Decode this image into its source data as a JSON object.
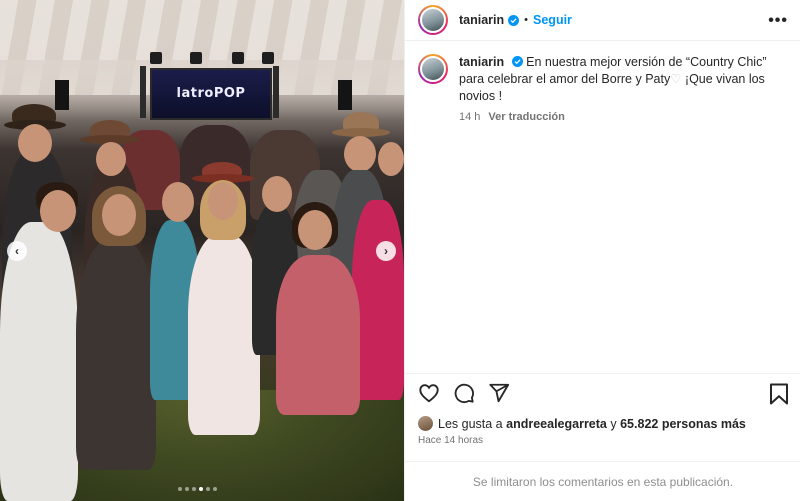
{
  "post": {
    "username": "taniarin",
    "follow_label": "Seguir",
    "separator": "•",
    "more_label": "•••"
  },
  "caption": {
    "username": "taniarin",
    "text_part1": "En nuestra mejor versión de “Country Chic” para celebrar el amor del Borre y Paty",
    "heart": "♡",
    "text_part2": " ¡Que vivan los novios !",
    "age": "14 h",
    "translate_label": "Ver traducción"
  },
  "media": {
    "screen_text": "latroPOP",
    "prev_label": "‹",
    "next_label": "›",
    "slide_count": 6,
    "active_slide": 4
  },
  "engagement": {
    "likes_prefix": "Les gusta a ",
    "liker": "andreealegarreta",
    "likes_mid": " y ",
    "likes_count": "65.822 personas más",
    "time_ago": "Hace 14 horas",
    "comments_disabled": "Se limitaron los comentarios en esta publicación."
  },
  "colors": {
    "link_blue": "#0095f6",
    "muted": "#737373",
    "border": "#efefef"
  },
  "icons": [
    "verified-badge-icon",
    "more-options-icon",
    "heart-icon",
    "comment-icon",
    "share-icon",
    "bookmark-icon",
    "chevron-left-icon",
    "chevron-right-icon"
  ]
}
